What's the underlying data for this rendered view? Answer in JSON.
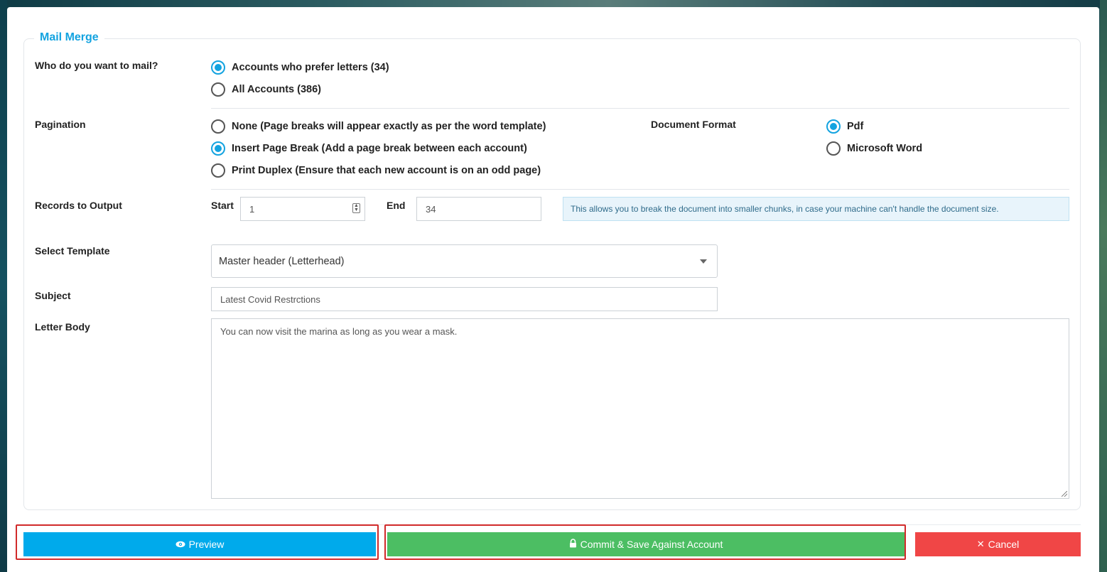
{
  "legend": "Mail Merge",
  "recipients": {
    "label": "Who do you want to mail?",
    "options": [
      {
        "label": "Accounts who prefer letters (34)",
        "selected": true
      },
      {
        "label": "All Accounts (386)",
        "selected": false
      }
    ]
  },
  "pagination": {
    "label": "Pagination",
    "options": [
      {
        "label": "None (Page breaks will appear exactly as per the word template)",
        "selected": false
      },
      {
        "label": "Insert Page Break (Add a page break between each account)",
        "selected": true
      },
      {
        "label": "Print Duplex (Ensure that each new account is on an odd page)",
        "selected": false
      }
    ]
  },
  "document_format": {
    "label": "Document Format",
    "options": [
      {
        "label": "Pdf",
        "selected": true
      },
      {
        "label": "Microsoft Word",
        "selected": false
      }
    ]
  },
  "records": {
    "label": "Records to Output",
    "start_label": "Start",
    "start_value": "1",
    "end_label": "End",
    "end_value": "34",
    "info": "This allows you to break the document into smaller chunks, in case your machine can't handle the document size."
  },
  "template": {
    "label": "Select Template",
    "value": "Master header (Letterhead)"
  },
  "subject": {
    "label": "Subject",
    "value": "Latest Covid Restrctions"
  },
  "letter_body": {
    "label": "Letter Body",
    "value": "You can now visit the marina as long as you wear a mask."
  },
  "buttons": {
    "preview": "Preview",
    "commit": "Commit & Save Against Account",
    "cancel": "Cancel"
  },
  "colors": {
    "accent": "#13a3e0",
    "preview": "#00aaeb",
    "commit": "#4cbe63",
    "cancel": "#f04646",
    "highlight": "#d12a2a"
  }
}
